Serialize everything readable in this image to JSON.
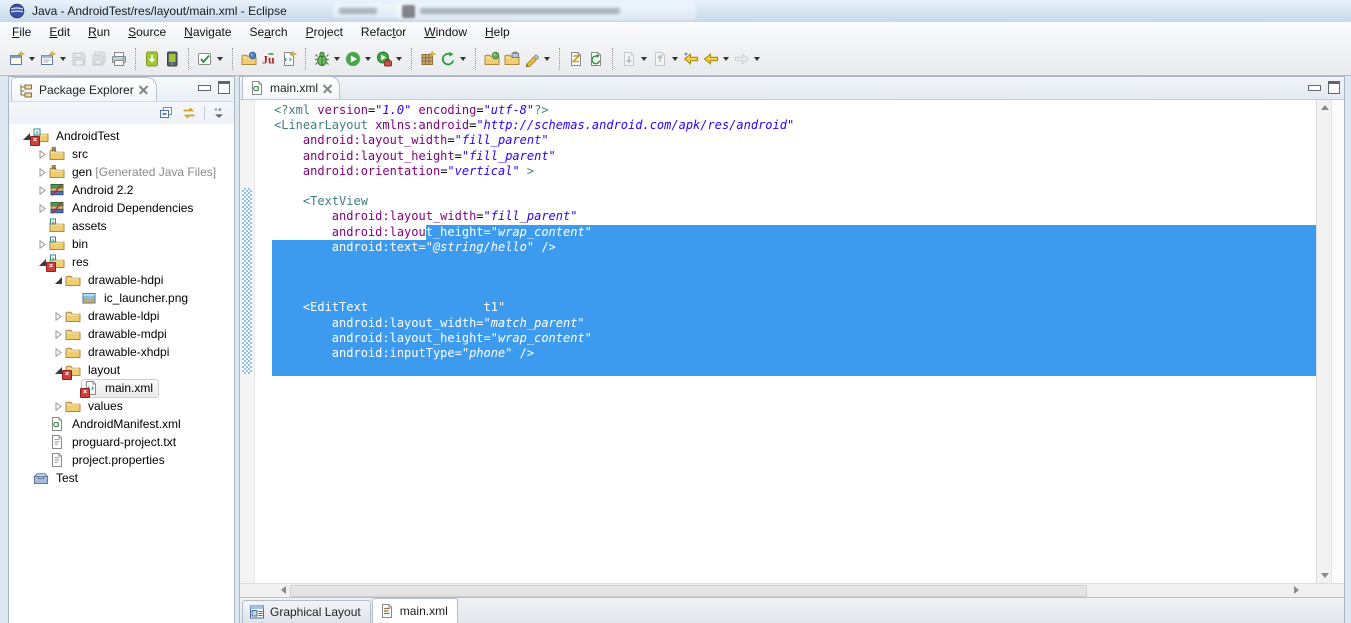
{
  "window": {
    "title": "Java - AndroidTest/res/layout/main.xml - Eclipse",
    "app_icon": "eclipse-logo-icon"
  },
  "menu": {
    "items": [
      {
        "label": "File",
        "u": 0
      },
      {
        "label": "Edit",
        "u": 0
      },
      {
        "label": "Run",
        "u": 0
      },
      {
        "label": "Source",
        "u": 0
      },
      {
        "label": "Navigate",
        "u": 0
      },
      {
        "label": "Search",
        "u": 2
      },
      {
        "label": "Project",
        "u": 0
      },
      {
        "label": "Refactor",
        "u": 5
      },
      {
        "label": "Window",
        "u": 0
      },
      {
        "label": "Help",
        "u": 0
      }
    ]
  },
  "toolbar": {
    "groups": [
      [
        {
          "icon": "new-wizard-icon",
          "dd": true
        },
        {
          "icon": "new-java-wizard-icon",
          "dd": true
        },
        {
          "icon": "save-icon",
          "disabled": true
        },
        {
          "icon": "save-all-icon",
          "disabled": true
        },
        {
          "icon": "print-icon"
        }
      ],
      [
        {
          "icon": "android-sdk-manager-icon"
        },
        {
          "icon": "android-virtual-device-manager-icon"
        }
      ],
      [
        {
          "icon": "lint-check-icon",
          "dd": true
        }
      ],
      [
        {
          "icon": "java-type-browse-icon"
        },
        {
          "icon": "junit-icon"
        },
        {
          "icon": "new-xml-file-icon"
        }
      ],
      [
        {
          "icon": "debug-icon",
          "dd": true
        },
        {
          "icon": "run-icon",
          "dd": true
        },
        {
          "icon": "run-external-icon",
          "dd": true
        }
      ],
      [
        {
          "icon": "new-java-project-icon"
        },
        {
          "icon": "team-sync-icon",
          "dd": true
        }
      ],
      [
        {
          "icon": "open-perspective-icon"
        },
        {
          "icon": "import-folder-icon"
        },
        {
          "icon": "mark-occurrences-icon",
          "dd": true
        }
      ],
      [
        {
          "icon": "last-edit-location-icon"
        },
        {
          "icon": "refresh-icon"
        }
      ],
      [
        {
          "icon": "next-annotation-icon",
          "dd": true,
          "disabled": true
        },
        {
          "icon": "prev-annotation-icon",
          "dd": true,
          "disabled": true
        },
        {
          "icon": "back-to-last-edit-icon"
        },
        {
          "icon": "back-icon",
          "dd": true
        },
        {
          "icon": "forward-icon",
          "dd": true,
          "disabled": true
        }
      ]
    ]
  },
  "package_explorer": {
    "title": "Package Explorer",
    "toolbar_icons": [
      "collapse-all-icon",
      "link-with-editor-icon",
      "view-menu-icon"
    ],
    "tree": [
      {
        "label": "AndroidTest",
        "level": 0,
        "expand": "open",
        "icon": "android-project",
        "badge": "error"
      },
      {
        "label": "src",
        "level": 1,
        "expand": "closed",
        "icon": "package-folder"
      },
      {
        "label": "gen",
        "suffix": " [Generated Java Files]",
        "level": 1,
        "expand": "closed",
        "icon": "package-folder"
      },
      {
        "label": "Android 2.2",
        "level": 1,
        "expand": "closed",
        "icon": "library"
      },
      {
        "label": "Android Dependencies",
        "level": 1,
        "expand": "closed",
        "icon": "library"
      },
      {
        "label": "assets",
        "level": 1,
        "expand": "none",
        "icon": "res-folder"
      },
      {
        "label": "bin",
        "level": 1,
        "expand": "closed",
        "icon": "res-folder"
      },
      {
        "label": "res",
        "level": 1,
        "expand": "open",
        "icon": "res-folder",
        "badge": "error"
      },
      {
        "label": "drawable-hdpi",
        "level": 2,
        "expand": "open",
        "icon": "folder"
      },
      {
        "label": "ic_launcher.png",
        "level": 3,
        "expand": "none",
        "icon": "image-file"
      },
      {
        "label": "drawable-ldpi",
        "level": 2,
        "expand": "closed",
        "icon": "folder"
      },
      {
        "label": "drawable-mdpi",
        "level": 2,
        "expand": "closed",
        "icon": "folder"
      },
      {
        "label": "drawable-xhdpi",
        "level": 2,
        "expand": "closed",
        "icon": "folder"
      },
      {
        "label": "layout",
        "level": 2,
        "expand": "open",
        "icon": "folder",
        "badge": "error"
      },
      {
        "label": "main.xml",
        "level": 3,
        "expand": "none",
        "icon": "xml-file",
        "badge": "error",
        "selected": true
      },
      {
        "label": "values",
        "level": 2,
        "expand": "closed",
        "icon": "folder"
      },
      {
        "label": "AndroidManifest.xml",
        "level": 1,
        "expand": "none",
        "icon": "android-file"
      },
      {
        "label": "proguard-project.txt",
        "level": 1,
        "expand": "none",
        "icon": "text-file"
      },
      {
        "label": "project.properties",
        "level": 1,
        "expand": "none",
        "icon": "text-file"
      },
      {
        "label": "Test",
        "level": 0,
        "expand": "none",
        "icon": "closed-project"
      }
    ]
  },
  "editor": {
    "tab": {
      "label": "main.xml",
      "icon": "android-xml-file-icon"
    },
    "colors": {
      "tag": "#3F7F7F",
      "attr": "#7F007F",
      "value": "#2A00FF",
      "selection": "#3D9BEF"
    },
    "code": {
      "lines": [
        {
          "sel": "none",
          "segs": [
            [
              "t",
              "<?xml "
            ],
            [
              "a",
              "version"
            ],
            [
              "p",
              "="
            ],
            [
              "v",
              "\"1.0\""
            ],
            [
              "p",
              " "
            ],
            [
              "a",
              "encoding"
            ],
            [
              "p",
              "="
            ],
            [
              "v",
              "\"utf-8\""
            ],
            [
              "t",
              "?>"
            ]
          ]
        },
        {
          "sel": "none",
          "segs": [
            [
              "t",
              "<LinearLayout "
            ],
            [
              "a",
              "xmlns:android"
            ],
            [
              "p",
              "="
            ],
            [
              "v",
              "\"http://schemas.android.com/apk/res/android\""
            ]
          ]
        },
        {
          "sel": "none",
          "segs": [
            [
              "p",
              "    "
            ],
            [
              "a",
              "android:layout_width"
            ],
            [
              "p",
              "="
            ],
            [
              "v",
              "\"fill_parent\""
            ]
          ]
        },
        {
          "sel": "none",
          "segs": [
            [
              "p",
              "    "
            ],
            [
              "a",
              "android:layout_height"
            ],
            [
              "p",
              "="
            ],
            [
              "v",
              "\"fill_parent\""
            ]
          ]
        },
        {
          "sel": "none",
          "segs": [
            [
              "p",
              "    "
            ],
            [
              "a",
              "android:orientation"
            ],
            [
              "p",
              "="
            ],
            [
              "v",
              "\"vertical\""
            ],
            [
              "t",
              " >"
            ]
          ]
        },
        {
          "sel": "none",
          "segs": []
        },
        {
          "sel": "none",
          "segs": [
            [
              "p",
              "    "
            ],
            [
              "t",
              "<TextView"
            ]
          ]
        },
        {
          "sel": "none",
          "segs": [
            [
              "p",
              "        "
            ],
            [
              "a",
              "android:layout_width"
            ],
            [
              "p",
              "="
            ],
            [
              "v",
              "\"fill_parent\""
            ]
          ]
        },
        {
          "sel": "partial",
          "segs": [
            [
              "p",
              "        "
            ],
            [
              "a",
              "android:layou"
            ]
          ],
          "selsegs": [
            [
              "w",
              "t_height="
            ],
            [
              "wv",
              "\"wrap_content\""
            ]
          ]
        },
        {
          "sel": "full",
          "segs": [
            [
              "w",
              "        android:text="
            ],
            [
              "wv",
              "\"@string/hello\""
            ],
            [
              "w",
              " />"
            ]
          ]
        },
        {
          "sel": "full",
          "segs": []
        },
        {
          "sel": "full",
          "segs": []
        },
        {
          "sel": "full",
          "segs": []
        },
        {
          "sel": "full",
          "segs": [
            [
              "w",
              "    <EditText                t1\""
            ]
          ]
        },
        {
          "sel": "full",
          "segs": [
            [
              "w",
              "        android:layout_width="
            ],
            [
              "wv",
              "\"match_parent\""
            ]
          ]
        },
        {
          "sel": "full",
          "segs": [
            [
              "w",
              "        android:layout_height="
            ],
            [
              "wv",
              "\"wrap_content\""
            ]
          ]
        },
        {
          "sel": "full",
          "segs": [
            [
              "w",
              "        android:inputType="
            ],
            [
              "wv",
              "\"phone\""
            ],
            [
              "w",
              " />"
            ]
          ]
        },
        {
          "sel": "full",
          "segs": []
        }
      ]
    }
  },
  "bottom_tabs": [
    {
      "label": "Graphical Layout",
      "icon": "graphical-layout-icon",
      "active": false
    },
    {
      "label": "main.xml",
      "icon": "source-page-icon",
      "active": true
    }
  ]
}
